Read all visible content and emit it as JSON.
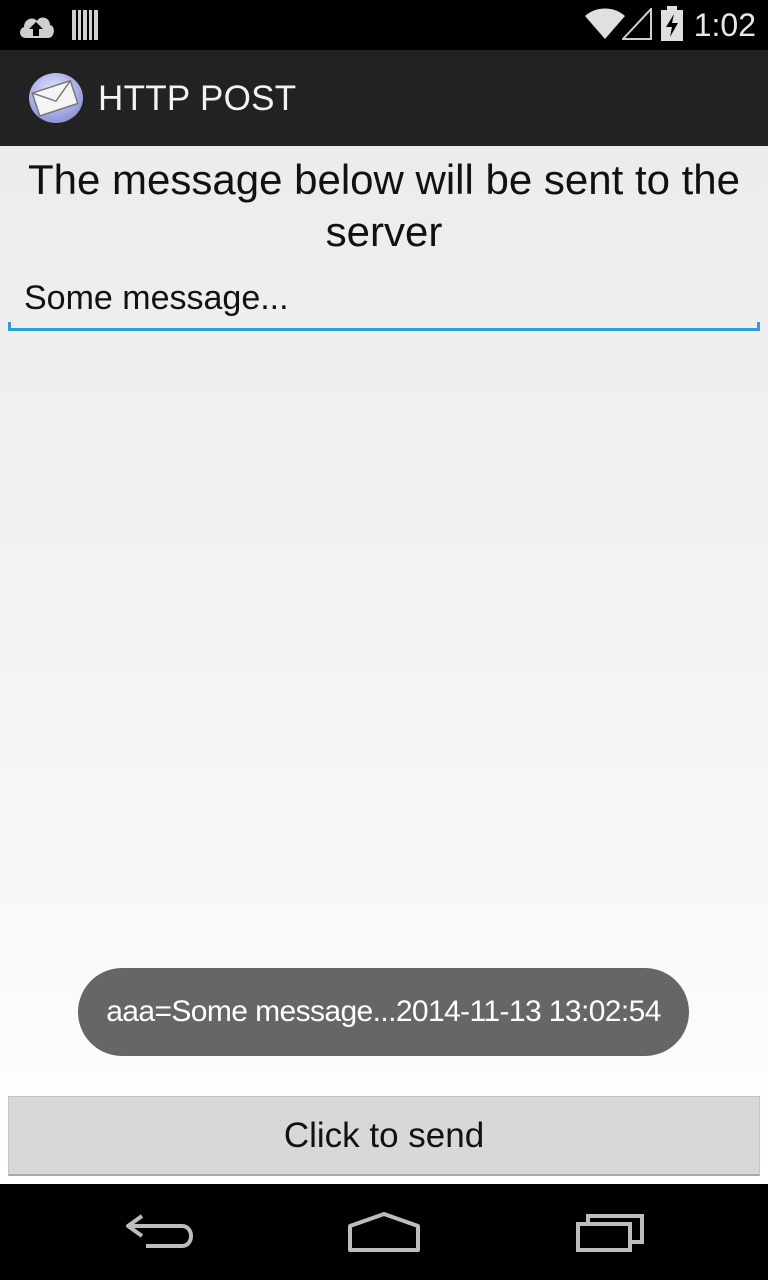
{
  "status_bar": {
    "time": "1:02",
    "icons": [
      "cloud-upload-icon",
      "barcode-icon",
      "wifi-icon",
      "cell-signal-icon",
      "battery-charging-icon"
    ]
  },
  "action_bar": {
    "icon": "envelope-icon",
    "title": "HTTP POST"
  },
  "main": {
    "heading": "The message below will be sent to the server",
    "message_value": "Some message...",
    "toast": "aaa=Some message...2014-11-13 13:02:54",
    "send_button_label": "Click to send"
  },
  "nav_bar": {
    "icons": [
      "back-icon",
      "home-icon",
      "recent-apps-icon"
    ]
  },
  "colors": {
    "accent": "#2b9fd6",
    "action_bar": "#222222",
    "toast": "#666666",
    "button": "#d8d8d8"
  }
}
